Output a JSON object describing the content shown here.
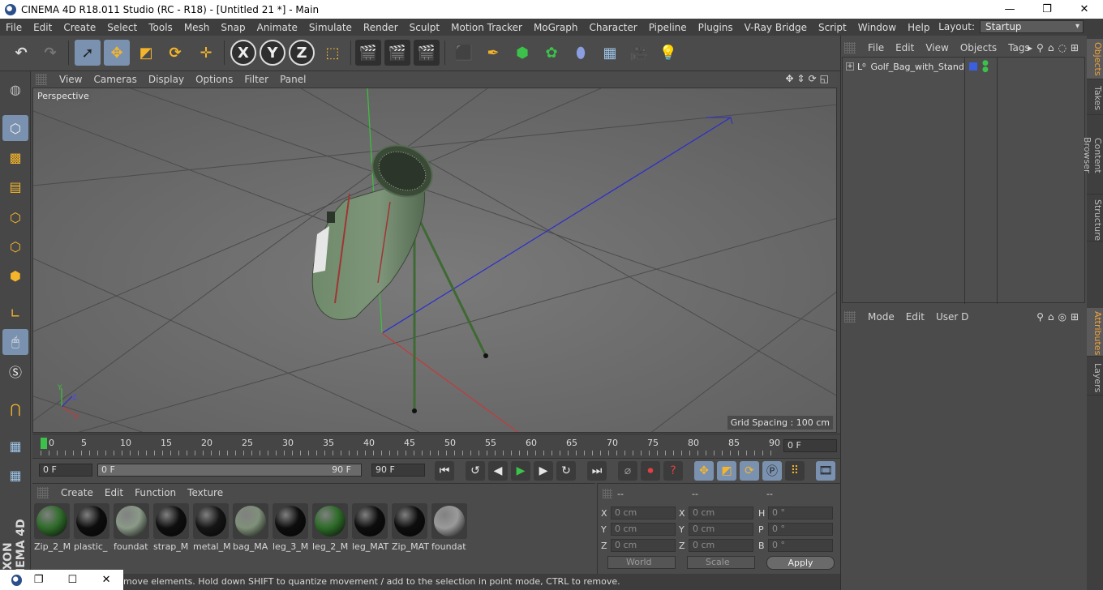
{
  "window": {
    "title": "CINEMA 4D R18.011 Studio (RC - R18) - [Untitled 21 *] - Main",
    "controls": [
      "—",
      "❐",
      "✕"
    ]
  },
  "menubar": {
    "items": [
      "File",
      "Edit",
      "Create",
      "Select",
      "Tools",
      "Mesh",
      "Snap",
      "Animate",
      "Simulate",
      "Render",
      "Sculpt",
      "Motion Tracker",
      "MoGraph",
      "Character",
      "Pipeline",
      "Plugins",
      "V-Ray Bridge",
      "Script",
      "Window",
      "Help"
    ],
    "layout_label": "Layout:",
    "layout_value": "Startup"
  },
  "toolbar": {
    "axis_x": "X",
    "axis_y": "Y",
    "axis_z": "Z"
  },
  "viewport": {
    "menu": [
      "View",
      "Cameras",
      "Display",
      "Options",
      "Filter",
      "Panel"
    ],
    "camera_label": "Perspective",
    "grid_spacing": "Grid Spacing : 100 cm",
    "axis_labels": {
      "x": "X",
      "y": "Y",
      "z": "Z"
    }
  },
  "timeline": {
    "ticks": [
      "0",
      "5",
      "10",
      "15",
      "20",
      "25",
      "30",
      "35",
      "40",
      "45",
      "50",
      "55",
      "60",
      "65",
      "70",
      "75",
      "80",
      "85",
      "90"
    ],
    "current_frame": "0 F"
  },
  "transport": {
    "start_field": "0 F",
    "range_start": "0 F",
    "range_end": "90 F",
    "end_field": "90 F"
  },
  "materials": {
    "menu": [
      "Create",
      "Edit",
      "Function",
      "Texture"
    ],
    "items": [
      {
        "name": "Zip_2_M",
        "color": "#2f6b2a"
      },
      {
        "name": "plastic_",
        "color": "#0d0d0d"
      },
      {
        "name": "foundat",
        "color": "#8a9a88"
      },
      {
        "name": "strap_M",
        "color": "#0e0e0e"
      },
      {
        "name": "metal_M",
        "color": "#151515"
      },
      {
        "name": "bag_MA",
        "color": "#7f9079"
      },
      {
        "name": "leg_3_M",
        "color": "#0d0d0d"
      },
      {
        "name": "leg_2_M",
        "color": "#2d6b28"
      },
      {
        "name": "leg_MAT",
        "color": "#0d0d0d"
      },
      {
        "name": "Zip_MAT",
        "color": "#0d0d0d"
      },
      {
        "name": "foundat",
        "color": "#9a9a9a"
      }
    ]
  },
  "coords": {
    "headers": [
      "--",
      "--",
      "--"
    ],
    "rows": [
      {
        "l1": "X",
        "v1": "0 cm",
        "l2": "X",
        "v2": "0 cm",
        "l3": "H",
        "v3": "0 °"
      },
      {
        "l1": "Y",
        "v1": "0 cm",
        "l2": "Y",
        "v2": "0 cm",
        "l3": "P",
        "v3": "0 °"
      },
      {
        "l1": "Z",
        "v1": "0 cm",
        "l2": "Z",
        "v2": "0 cm",
        "l3": "B",
        "v3": "0 °"
      }
    ],
    "space": "World",
    "mode": "Scale",
    "apply": "Apply"
  },
  "status": {
    "text": "move elements. Hold down SHIFT to quantize movement / add to the selection in point mode, CTRL to remove."
  },
  "taskbar_window": {
    "controls": [
      "❐",
      "☐",
      "✕"
    ]
  },
  "objects_panel": {
    "menu": [
      "File",
      "Edit",
      "View",
      "Objects",
      "Tags"
    ],
    "object_name": "Golf_Bag_with_Stand",
    "tag_color": "#3a5fe0"
  },
  "attributes_panel": {
    "menu": [
      "Mode",
      "Edit",
      "User D"
    ]
  },
  "sidetabs": [
    "Objects",
    "Takes",
    "Content Browser",
    "Structure",
    "Attributes",
    "Layers"
  ],
  "branding": {
    "line1": "MAXON",
    "line2": "CINEMA 4D"
  }
}
